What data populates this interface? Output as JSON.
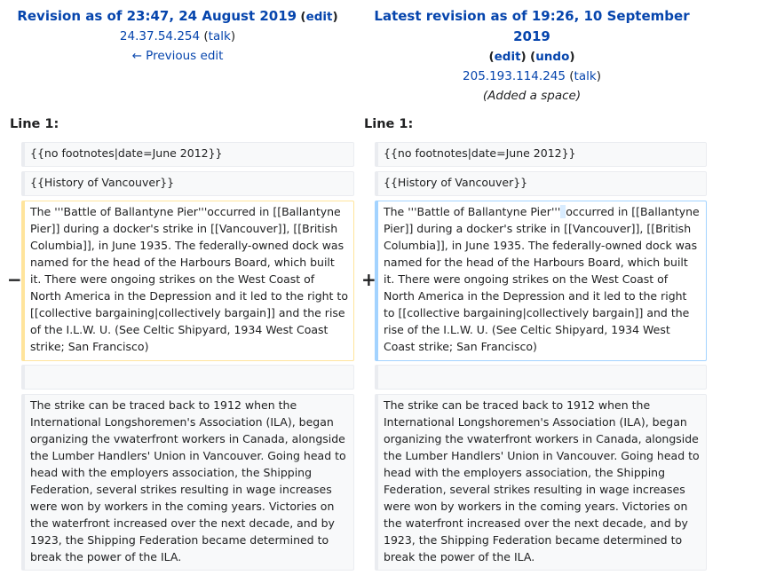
{
  "left": {
    "title": "Revision as of 23:47, 24 August 2019",
    "edit_link": "edit",
    "user": "24.37.54.254",
    "talk": "talk",
    "nav": "← Previous edit"
  },
  "right": {
    "title": "Latest revision as of 19:26, 10 September 2019",
    "edit_link": "edit",
    "undo_link": "undo",
    "user": "205.193.114.245",
    "talk": "talk",
    "summary": "(Added a space)"
  },
  "line_labels": {
    "left": "Line 1:",
    "right": "Line 1:"
  },
  "markers": {
    "minus": "−",
    "plus": "+"
  },
  "rows": {
    "r1": {
      "left": "{{no footnotes|date=June 2012}}",
      "right": "{{no footnotes|date=June 2012}}"
    },
    "r2": {
      "left": "{{History of Vancouver}}",
      "right": "{{History of Vancouver}}"
    },
    "r3": {
      "left": "The '''Battle of Ballantyne Pier'''occurred in [[Ballantyne Pier]] during a docker's strike in [[Vancouver]], [[British Columbia]], in June 1935. The federally-owned dock was named for the head of the Harbours Board, which built it. There were ongoing strikes on the West Coast of North America in the Depression and it led to the right to [[collective bargaining|collectively bargain]] and the rise of the I.L.W. U. (See Celtic Shipyard, 1934 West Coast strike; San Francisco)",
      "right_before": "The '''Battle of Ballantyne Pier'''",
      "right_inserted": " ",
      "right_after": "occurred in [[Ballantyne Pier]] during a docker's strike in [[Vancouver]], [[British Columbia]], in June 1935. The federally-owned dock was named for the head of the Harbours Board, which built it. There were ongoing strikes on the West Coast of North America in the Depression and it led to the right to [[collective bargaining|collectively bargain]] and the rise of the I.L.W. U. (See Celtic Shipyard, 1934 West Coast strike; San Francisco)"
    },
    "r5": {
      "left": "The strike can be traced back to 1912 when the International Longshoremen's Association (ILA), began organizing the vwaterfront workers in Canada, alongside the Lumber Handlers' Union in Vancouver. Going head to head with the employers association, the Shipping Federation, several strikes resulting in wage increases were won by workers in the coming years. Victories on the waterfront increased over the next decade, and by 1923, the Shipping Federation became determined to break the power of the ILA.",
      "right": "The strike can be traced back to 1912 when the International Longshoremen's Association (ILA), began organizing the vwaterfront workers in Canada, alongside the Lumber Handlers' Union in Vancouver. Going head to head with the employers association, the Shipping Federation, several strikes resulting in wage increases were won by workers in the coming years. Victories on the waterfront increased over the next decade, and by 1923, the Shipping Federation became determined to break the power of the ILA."
    }
  }
}
